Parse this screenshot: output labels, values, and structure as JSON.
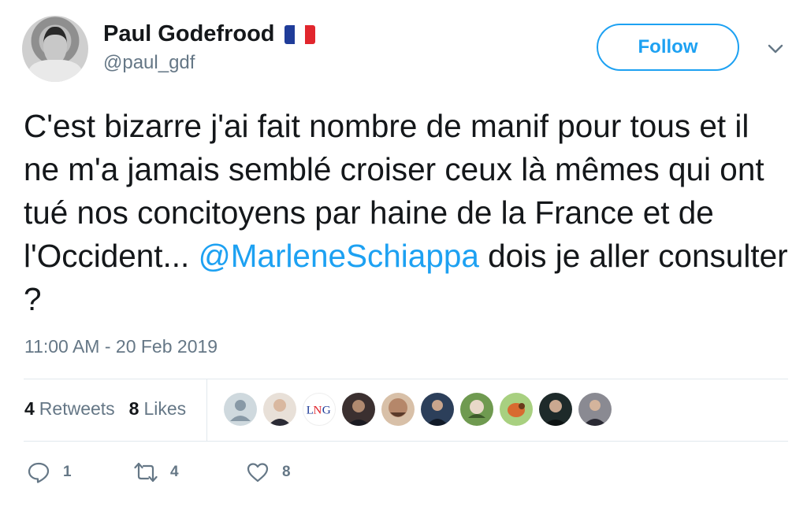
{
  "author": {
    "display_name": "Paul Godefrood",
    "handle": "@paul_gdf",
    "flag_colors": [
      "#1f3c99",
      "#ffffff",
      "#e1262d"
    ]
  },
  "header": {
    "follow_label": "Follow",
    "menu_icon": "chevron-down-icon"
  },
  "tweet": {
    "text_before_mention": "C'est bizarre j'ai fait nombre de manif pour tous et il ne m'a jamais semblé croiser ceux là mêmes qui ont tué nos concitoyens par haine de la France et de l'Occident... ",
    "mention": "@MarleneSchiappa",
    "text_after_mention": " dois je aller consulter ?",
    "timestamp": "11:00 AM - 20 Feb 2019"
  },
  "stats": {
    "retweets_count": "4",
    "retweets_label": "Retweets",
    "likes_count": "8",
    "likes_label": "Likes"
  },
  "likers": [
    {
      "name": "default-avatar",
      "color": "#cfd9de"
    },
    {
      "name": "avatar-2",
      "color": "#e8d8c8"
    },
    {
      "name": "avatar-lng-logo",
      "color": "#ffffff"
    },
    {
      "name": "avatar-4",
      "color": "#3b3030"
    },
    {
      "name": "avatar-5",
      "color": "#b58a6a"
    },
    {
      "name": "avatar-6",
      "color": "#2c3f5a"
    },
    {
      "name": "avatar-7",
      "color": "#7aa05a"
    },
    {
      "name": "avatar-8",
      "color": "#9dc870"
    },
    {
      "name": "avatar-9",
      "color": "#1e2a2a"
    },
    {
      "name": "avatar-10",
      "color": "#6c6c74"
    }
  ],
  "actions": {
    "reply_count": "1",
    "retweet_count": "4",
    "like_count": "8"
  },
  "colors": {
    "accent": "#1da1f2",
    "secondary_text": "#657786",
    "primary_text": "#14171a",
    "divider": "#e1e8ed"
  }
}
